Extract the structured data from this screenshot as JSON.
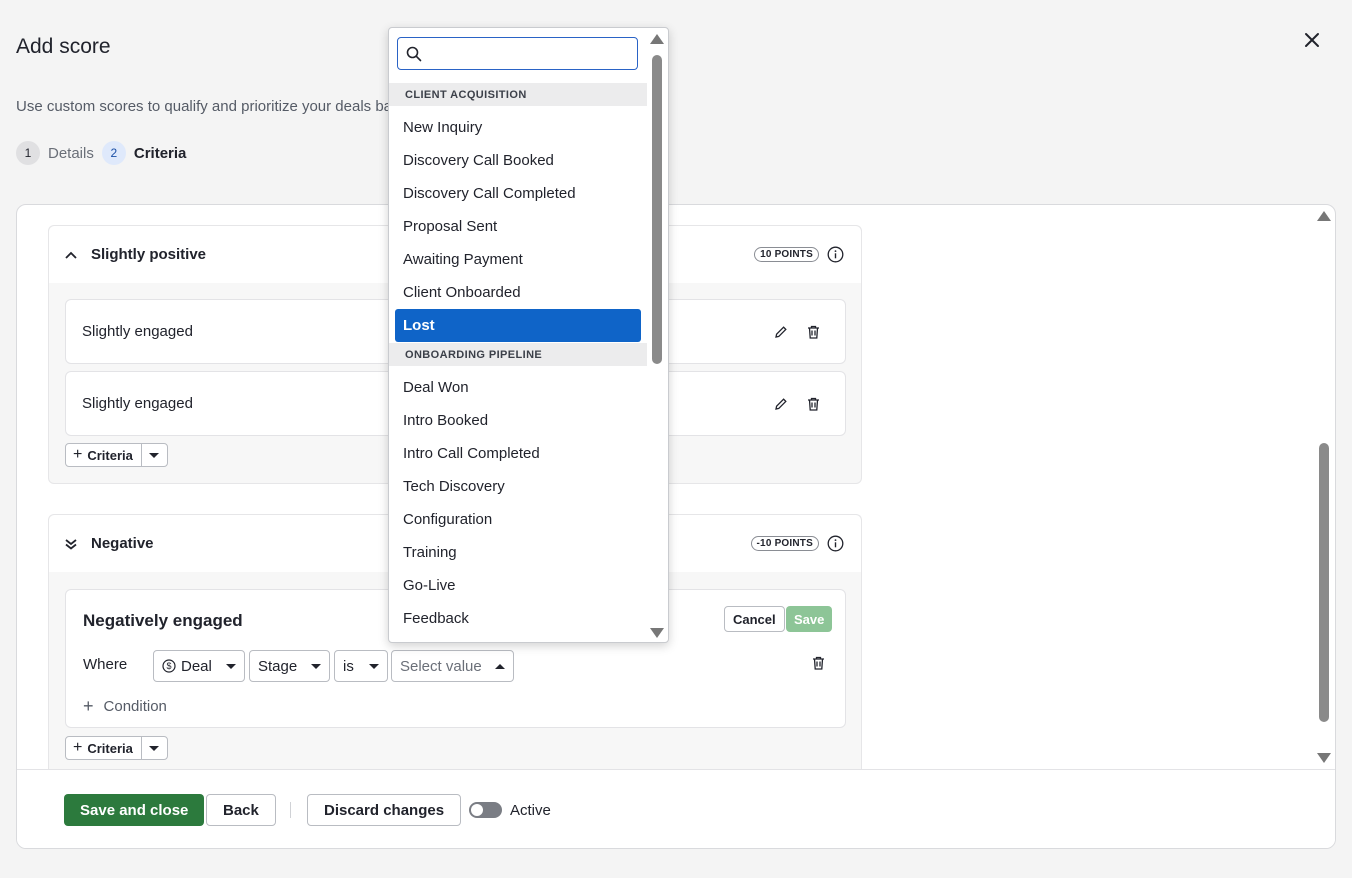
{
  "modal": {
    "title": "Add score",
    "subtitle": "Use custom scores to qualify and prioritize your deals ba"
  },
  "steps": [
    {
      "number": "1",
      "label": "Details"
    },
    {
      "number": "2",
      "label": "Criteria"
    }
  ],
  "groups": {
    "slightly_positive": {
      "title": "Slightly positive",
      "points": "10 POINTS",
      "criteria": [
        "Slightly engaged",
        "Slightly engaged"
      ],
      "add_criteria_label": "Criteria"
    },
    "negative": {
      "title": "Negative",
      "points": "-10 POINTS",
      "edit": {
        "title": "Negatively engaged",
        "cancel_label": "Cancel",
        "save_label": "Save",
        "where_label": "Where",
        "entity": "Deal",
        "field": "Stage",
        "operator": "is",
        "value_placeholder": "Select value",
        "add_condition_label": "Condition"
      },
      "add_criteria_label": "Criteria"
    }
  },
  "footer": {
    "save_close_label": "Save and close",
    "back_label": "Back",
    "discard_label": "Discard changes",
    "active_label": "Active",
    "active": false
  },
  "dropdown": {
    "search_value": "",
    "groups": [
      {
        "label": "CLIENT ACQUISITION",
        "options": [
          "New Inquiry",
          "Discovery Call Booked",
          "Discovery Call Completed",
          "Proposal Sent",
          "Awaiting Payment",
          "Client Onboarded",
          "Lost"
        ]
      },
      {
        "label": "ONBOARDING PIPELINE",
        "options": [
          "Deal Won",
          "Intro Booked",
          "Intro Call Completed",
          "Tech Discovery",
          "Configuration",
          "Training",
          "Go-Live",
          "Feedback"
        ]
      }
    ],
    "selected": "Lost"
  },
  "colors": {
    "primary_green": "#2c7a3d",
    "save_disabled_green": "#8dc597",
    "selected_blue": "#0f64c8",
    "focus_blue": "#2a63c6"
  }
}
